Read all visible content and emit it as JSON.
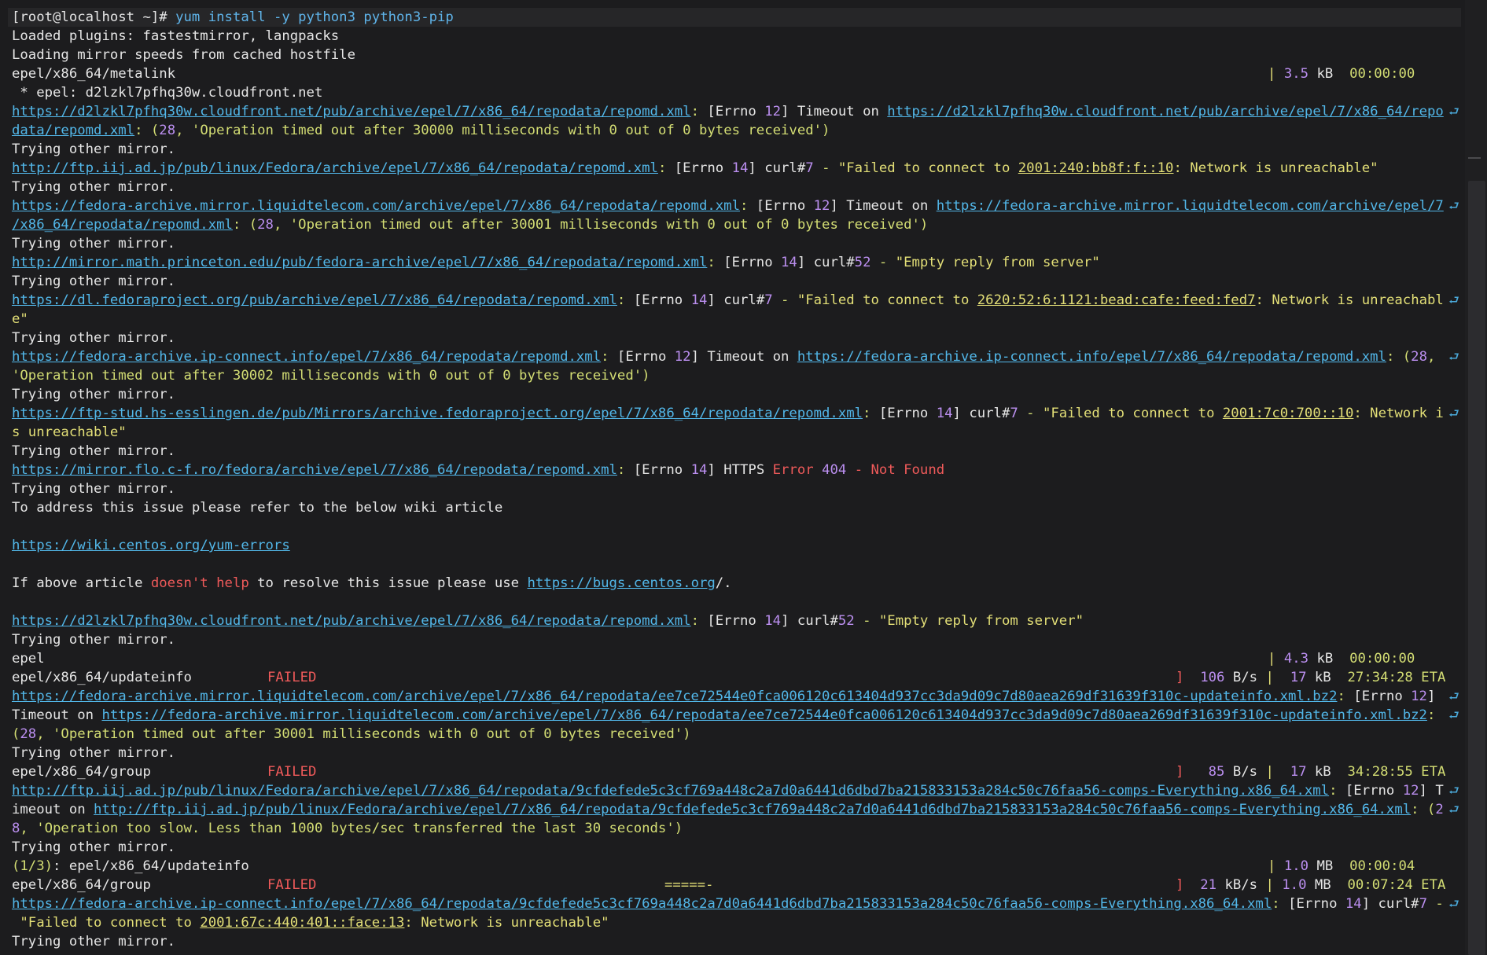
{
  "terminal": {
    "prompt": "[root@localhost ~]# ",
    "command": "yum install -y python3 python3-pip",
    "header_lines": [
      "Loaded plugins: fastestmirror, langpacks",
      "Loading mirror speeds from cached hostfile",
      "epel/x86_64/metalink",
      " * epel: d2lzkl7pfhq30w.cloudfront.net"
    ],
    "trying": "Trying other mirror.",
    "urls": {
      "cf_repomd": "https://d2lzkl7pfhq30w.cloudfront.net/pub/archive/epel/7/x86_64/repodata/repomd.xml",
      "cf_repomd_a": "https://d2lzkl7pfhq30w.cloudfront.net/pub/archive/epel/7/x86_64/repo",
      "cf_repomd_b": "data/repomd.xml",
      "iij_repomd": "http://ftp.iij.ad.jp/pub/linux/Fedora/archive/epel/7/x86_64/repodata/repomd.xml",
      "lt_repomd": "https://fedora-archive.mirror.liquidtelecom.com/archive/epel/7/x86_64/repodata/repomd.xml",
      "lt_repomd_a": "https://fedora-archive.mirror.liquidtelecom.com/archive/epel/7",
      "lt_repomd_b": "/x86_64/repodata/repomd.xml",
      "princeton_repomd": "http://mirror.math.princeton.edu/pub/fedora-archive/epel/7/x86_64/repodata/repomd.xml",
      "dl_repomd": "https://dl.fedoraproject.org/pub/archive/epel/7/x86_64/repodata/repomd.xml",
      "ipc_repomd": "https://fedora-archive.ip-connect.info/epel/7/x86_64/repodata/repomd.xml",
      "hs_repomd": "https://ftp-stud.hs-esslingen.de/pub/Mirrors/archive.fedoraproject.org/epel/7/x86_64/repodata/repomd.xml",
      "flo_repomd": "https://mirror.flo.c-f.ro/fedora/archive/epel/7/x86_64/repodata/repomd.xml",
      "wiki": "https://wiki.centos.org/yum-errors",
      "bugs": "https://bugs.centos.org",
      "lt_updateinfo": "https://fedora-archive.mirror.liquidtelecom.com/archive/epel/7/x86_64/repodata/ee7ce72544e0fca006120c613404d937cc3da9d09c7d80aea269df31639f310c-updateinfo.xml.bz2",
      "iij_comps": "http://ftp.iij.ad.jp/pub/linux/Fedora/archive/epel/7/x86_64/repodata/9cfdefede5c3cf769a448c2a7d0a6441d6dbd7ba215833153a284c50c76faa56-comps-Everything.x86_64.xml",
      "ipc_comps": "https://fedora-archive.ip-connect.info/epel/7/x86_64/repodata/9cfdefede5c3cf769a448c2a7d0a6441d6dbd7ba215833153a284c50c76faa56-comps-Everything.x86_64.xml"
    },
    "addrs": {
      "iij": "2001:240:bb8f:f::10",
      "dl": "2620:52:6:1121:bead:cafe:feed:fed7",
      "hs": "2001:7c0:700::10",
      "ipc": "2001:67c:440:401::face:13"
    },
    "msg": {
      "timeout_on": "Timeout on ",
      "timed_out_30000": "'Operation timed out after 30000 milliseconds with 0 out of 0 bytes received'",
      "timed_out_30001": "'Operation timed out after 30001 milliseconds with 0 out of 0 bytes received'",
      "timed_out_30002": "'Operation timed out after 30002 milliseconds with 0 out of 0 bytes received'",
      "too_slow": "'Operation too slow. Less than 1000 bytes/sec transferred the last 30 seconds'",
      "failed_connect": "\"Failed to connect to ",
      "net_unreachable": ": Network is unreachable\"",
      "net_unreachable_hs_a": ": Network i",
      "net_unreachable_hs_b": "s unreachable\"",
      "empty_reply": "\"Empty reply from server\"",
      "https_404_a": "HTTPS ",
      "https_404_b": "Error ",
      "https_404_c": "404",
      "https_404_d": " - Not Found",
      "wiki_intro": "To address this issue please refer to the below wiki article",
      "if_above_a": "If above article ",
      "if_above_b": "doesn't help",
      "if_above_c": " to resolve this issue please use "
    },
    "progress": {
      "metalink": {
        "size_num": "3.5",
        "size_unit": "kB",
        "time": "00:00:00"
      },
      "epel": {
        "name": "epel",
        "size_num": "4.3",
        "size_unit": "kB",
        "time": "00:00:00"
      },
      "updateinfo_failed": {
        "name": "epel/x86_64/updateinfo",
        "status": "FAILED",
        "rate_num": "106",
        "rate_unit": "B/s",
        "size_num": "17",
        "size_unit": "kB",
        "eta": "27:34:28 ETA"
      },
      "group_failed_1": {
        "name": "epel/x86_64/group",
        "status": "FAILED",
        "rate_num": "85",
        "rate_unit": "B/s",
        "size_num": "17",
        "size_unit": "kB",
        "eta": "34:28:55 ETA"
      },
      "updateinfo_done": {
        "counter": "(1/3)",
        "name": ": epel/x86_64/updateinfo",
        "size_num": "1.0",
        "size_unit": "MB",
        "time": "00:00:04"
      },
      "group_failed_2": {
        "name": "epel/x86_64/group",
        "status": "FAILED",
        "bar": "=====-",
        "rate_num": "21",
        "rate_unit": "kB/s",
        "size_num": "1.0",
        "size_unit": "MB",
        "eta": "00:07:24 ETA"
      }
    }
  }
}
